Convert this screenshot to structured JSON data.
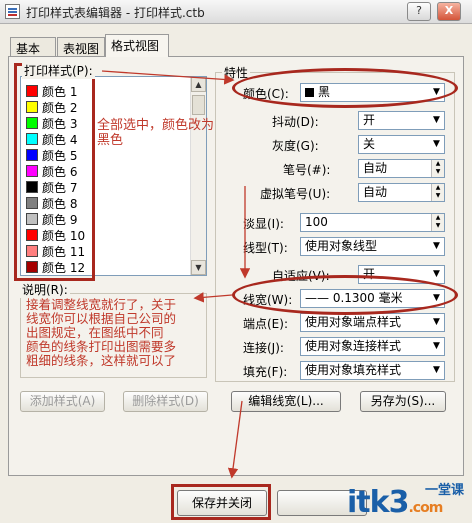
{
  "window": {
    "title": "打印样式表编辑器 - 打印样式.ctb",
    "help_btn": "?",
    "close_btn": "X"
  },
  "tabs": [
    {
      "label": "基本"
    },
    {
      "label": "表视图"
    },
    {
      "label": "格式视图"
    }
  ],
  "styles": {
    "title": "打印样式(P):",
    "items": [
      {
        "label": "颜色 1",
        "color": "#ff0000"
      },
      {
        "label": "颜色 2",
        "color": "#ffff00"
      },
      {
        "label": "颜色 3",
        "color": "#00ff00"
      },
      {
        "label": "颜色 4",
        "color": "#00ffff"
      },
      {
        "label": "颜色 5",
        "color": "#0000ff"
      },
      {
        "label": "颜色 6",
        "color": "#ff00ff"
      },
      {
        "label": "颜色 7",
        "color": "#000000"
      },
      {
        "label": "颜色 8",
        "color": "#808080"
      },
      {
        "label": "颜色 9",
        "color": "#c0c0c0"
      },
      {
        "label": "颜色 10",
        "color": "#ff0000"
      },
      {
        "label": "颜色 11",
        "color": "#ff7f7f"
      },
      {
        "label": "颜色 12",
        "color": "#a50000"
      }
    ]
  },
  "description": {
    "title": "说明(R):"
  },
  "properties": {
    "title": "特性",
    "color": {
      "label": "颜色(C):",
      "value": "黑"
    },
    "dither": {
      "label": "抖动(D):",
      "value": "开"
    },
    "grayscale": {
      "label": "灰度(G):",
      "value": "关"
    },
    "pen": {
      "label": "笔号(#):",
      "value": "自动"
    },
    "virtual_pen": {
      "label": "虚拟笔号(U):",
      "value": "自动"
    },
    "screening": {
      "label": "淡显(I):",
      "value": "100"
    },
    "linetype": {
      "label": "线型(T):",
      "value": "使用对象线型"
    },
    "adaptive": {
      "label": "自适应(V):",
      "value": "开"
    },
    "lineweight": {
      "label": "线宽(W):",
      "value": "—— 0.1300 毫米"
    },
    "endstyle": {
      "label": "端点(E):",
      "value": "使用对象端点样式"
    },
    "joinstyle": {
      "label": "连接(J):",
      "value": "使用对象连接样式"
    },
    "fillstyle": {
      "label": "填充(F):",
      "value": "使用对象填充样式"
    }
  },
  "buttons": {
    "add_style": "添加样式(A)",
    "delete_style": "删除样式(D)",
    "edit_lineweights": "编辑线宽(L)...",
    "save_as": "另存为(S)...",
    "save_close": "保存并关闭"
  },
  "annotations": {
    "note1_line1": "全部选中，颜色改为",
    "note1_line2": "黑色",
    "note2_line1": "接着调整线宽就行了，关于",
    "note2_line2": "线宽你可以根据自己公司的",
    "note2_line3": "出图规定，在图纸中不同",
    "note2_line4": "颜色的线条打印出图需要多",
    "note2_line5": "粗细的线条，这样就可以了",
    "color": "#c0392b"
  },
  "watermark": {
    "brand": "itk3",
    "suffix": ".com",
    "cn": "一堂课"
  }
}
